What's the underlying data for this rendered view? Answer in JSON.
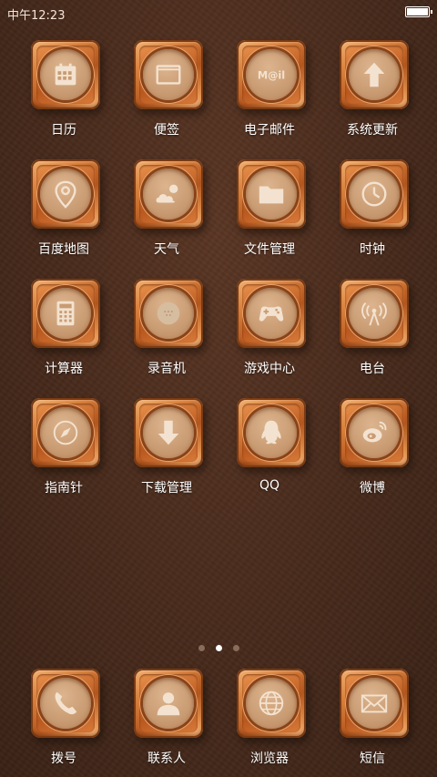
{
  "status_bar": {
    "time": "中午12:23",
    "battery_level": 1.0
  },
  "apps": [
    {
      "label": "日历",
      "icon": "calendar-icon"
    },
    {
      "label": "便签",
      "icon": "notepad-icon"
    },
    {
      "label": "电子邮件",
      "icon": "mail-icon"
    },
    {
      "label": "系统更新",
      "icon": "upload-arrow-icon"
    },
    {
      "label": "百度地图",
      "icon": "map-pin-icon"
    },
    {
      "label": "天气",
      "icon": "weather-icon"
    },
    {
      "label": "文件管理",
      "icon": "folder-icon"
    },
    {
      "label": "时钟",
      "icon": "clock-icon"
    },
    {
      "label": "计算器",
      "icon": "calculator-icon"
    },
    {
      "label": "录音机",
      "icon": "recorder-icon"
    },
    {
      "label": "游戏中心",
      "icon": "gamepad-icon"
    },
    {
      "label": "电台",
      "icon": "radio-antenna-icon"
    },
    {
      "label": "指南针",
      "icon": "compass-icon"
    },
    {
      "label": "下载管理",
      "icon": "download-arrow-icon"
    },
    {
      "label": "QQ",
      "icon": "qq-penguin-icon"
    },
    {
      "label": "微博",
      "icon": "weibo-icon"
    }
  ],
  "mail_icon_text": "M@il",
  "page_indicator": {
    "count": 3,
    "active": 1
  },
  "dock": [
    {
      "label": "拨号",
      "icon": "phone-icon"
    },
    {
      "label": "联系人",
      "icon": "contact-icon"
    },
    {
      "label": "浏览器",
      "icon": "globe-icon"
    },
    {
      "label": "短信",
      "icon": "envelope-icon"
    }
  ],
  "colors": {
    "background": "#4a2c1d",
    "tile": "#d97f3a",
    "disc": "#c99b72",
    "glyph": "#f3e2cf"
  }
}
